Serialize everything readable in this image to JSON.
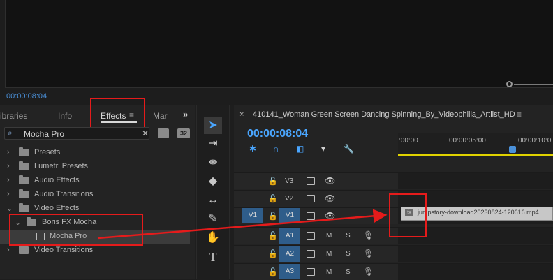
{
  "monitor": {
    "timecode": "00:00:08:04"
  },
  "left_panel": {
    "tabs": [
      {
        "label": "ibraries"
      },
      {
        "label": "Info"
      },
      {
        "label": "Effects"
      },
      {
        "label": "Mar"
      }
    ],
    "menu_icon": "hamburger-icon",
    "overflow_icon": "chevron-double-right-icon",
    "search": {
      "value": "Mocha Pro"
    },
    "search_buttons": [
      "32"
    ],
    "tree": [
      {
        "label": "Presets",
        "expanded": false
      },
      {
        "label": "Lumetri Presets",
        "expanded": false
      },
      {
        "label": "Audio Effects",
        "expanded": false
      },
      {
        "label": "Audio Transitions",
        "expanded": false
      },
      {
        "label": "Video Effects",
        "expanded": true
      },
      {
        "label": "Boris FX Mocha",
        "expanded": true
      },
      {
        "label": "Mocha Pro",
        "selected": true
      },
      {
        "label": "Video Transitions",
        "expanded": false
      }
    ]
  },
  "tools": [
    "selection-tool",
    "track-select-tool",
    "ripple-edit-tool",
    "razor-tool",
    "slip-tool",
    "pen-tool",
    "hand-tool",
    "type-tool"
  ],
  "timeline": {
    "sequence_name": "410141_Woman Green Screen Dancing Spinning_By_Videophilia_Artlist_HD",
    "timecode": "00:00:08:04",
    "ruler": [
      ":00:00",
      "00:00:05:00",
      "00:00:10:0"
    ],
    "tracks": [
      {
        "name": "V3",
        "type": "video"
      },
      {
        "name": "V2",
        "type": "video"
      },
      {
        "name": "V1",
        "type": "video",
        "source": "V1"
      },
      {
        "name": "A1",
        "type": "audio",
        "buttons": [
          "M",
          "S"
        ]
      },
      {
        "name": "A2",
        "type": "audio",
        "buttons": [
          "M",
          "S"
        ]
      },
      {
        "name": "A3",
        "type": "audio",
        "buttons": [
          "M",
          "S"
        ]
      }
    ],
    "clip": {
      "name": "jumpstory-download20230824-120616.mp4",
      "fx": "fx"
    }
  },
  "colors": {
    "accent": "#4aa6ff",
    "highlight_box": "#e51b1b",
    "work_area": "#e0d200"
  }
}
